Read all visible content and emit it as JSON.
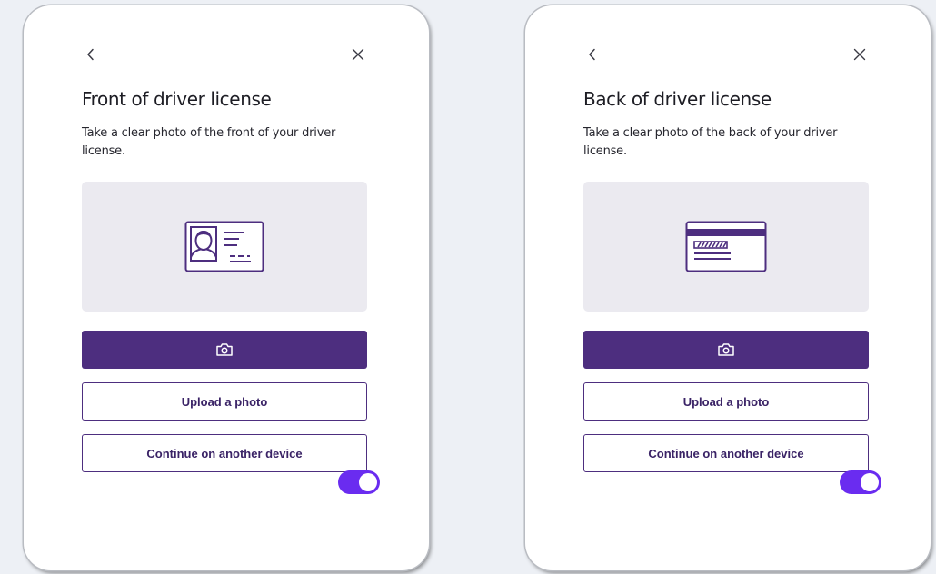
{
  "cards": [
    {
      "title": "Front of driver license",
      "description": "Take a clear photo of the front of your driver license.",
      "illustration_icon": "id-card-front-icon",
      "camera_icon": "camera-icon",
      "upload_label": "Upload a photo",
      "continue_label": "Continue on another device",
      "toggle_on": true
    },
    {
      "title": "Back of driver license",
      "description": "Take a clear photo of the back of your driver license.",
      "illustration_icon": "id-card-back-icon",
      "camera_icon": "camera-icon",
      "upload_label": "Upload a photo",
      "continue_label": "Continue on another device",
      "toggle_on": true
    }
  ],
  "colors": {
    "primary": "#4d2e7f",
    "illustration_bg": "#ebeaf0",
    "toggle": "#6a2cf0",
    "page_bg": "#edf0f5"
  }
}
